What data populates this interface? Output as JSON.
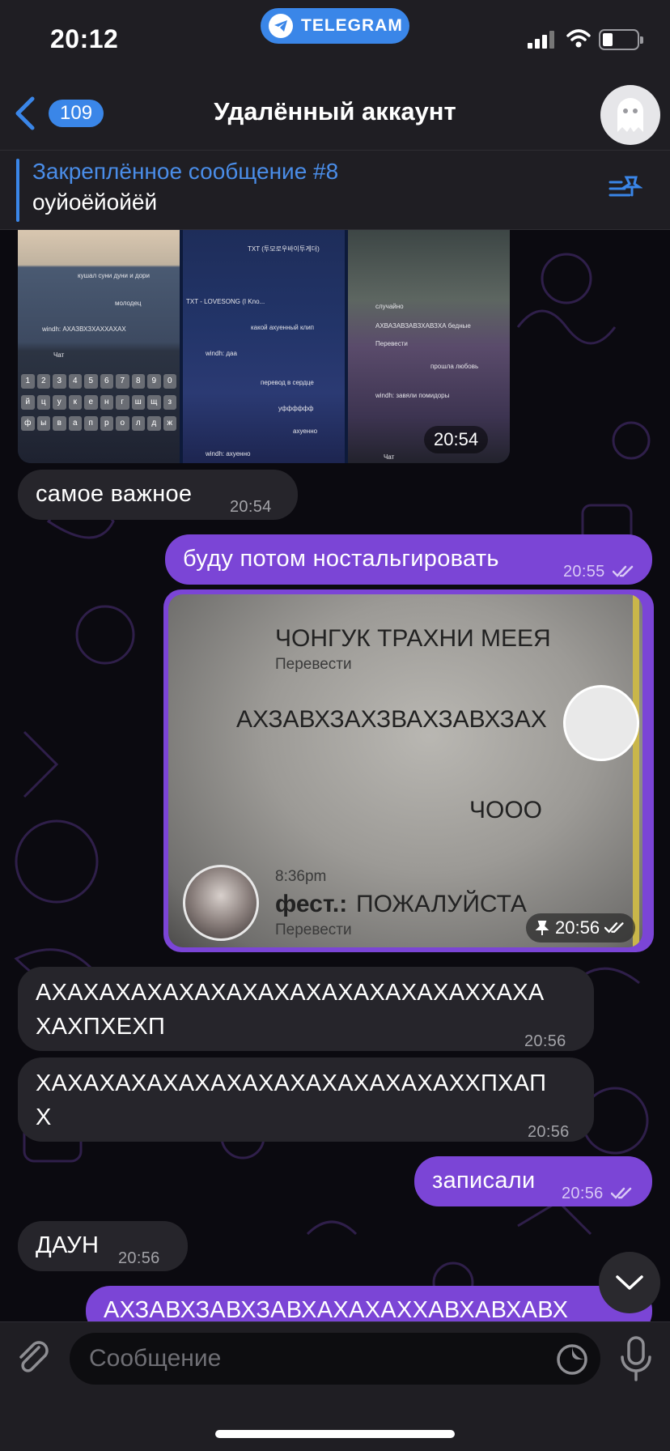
{
  "status_bar": {
    "time": "20:12",
    "app_pill": "TELEGRAM"
  },
  "header": {
    "back_count": "109",
    "title": "Удалённый аккаунт"
  },
  "pinned": {
    "title": "Закреплённое сообщение #8",
    "text": "оуйоёйойёй"
  },
  "media_group": {
    "time": "20:54",
    "screenshots": [
      {
        "lines": [
          "кушал суни дуни и дори",
          "молодец",
          "windh: АХАЗВХЗХАХХАХАХ",
          "Чат"
        ]
      },
      {
        "lines": [
          "TXT (투모로우바이투게더)",
          "TXT - LOVESONG (I Kno...",
          "какой ахуенный клип",
          "windh: даа",
          "перевод в сердце",
          "уфффффф",
          "ахуенно",
          "windh: ахуенно"
        ]
      },
      {
        "lines": [
          "случайно",
          "АХВАЗАВЗАВЗХАВЗХА бедные",
          "Перевести",
          "прошла любовь",
          "windh: завяли помидоры",
          "Чат"
        ]
      }
    ],
    "keyboard_rows": [
      [
        "1",
        "2",
        "3",
        "4",
        "5",
        "6",
        "7",
        "8",
        "9",
        "0"
      ],
      [
        "й",
        "ц",
        "у",
        "к",
        "е",
        "н",
        "г",
        "ш",
        "щ",
        "з"
      ],
      [
        "ф",
        "ы",
        "в",
        "а",
        "п",
        "р",
        "о",
        "л",
        "д",
        "ж"
      ]
    ]
  },
  "messages": [
    {
      "id": "m1",
      "dir": "in",
      "text": "самое важное",
      "time": "20:54"
    },
    {
      "id": "m2",
      "dir": "out",
      "text": "буду потом ностальгировать",
      "time": "20:55"
    },
    {
      "id": "m3",
      "dir": "out",
      "type": "photo",
      "time": "20:56",
      "photo": {
        "line1": "ЧОНГУК ТРАХНИ МЕЕЯ",
        "translate1": "Перевести",
        "line2": "АХЗАВХЗАХЗВАХЗАВХЗАХ",
        "line3": "ЧОOO",
        "stamp": "8:36pm",
        "sender": "фест.:",
        "line4": "ПОЖАЛУЙСТА",
        "translate2": "Перевести"
      }
    },
    {
      "id": "m4",
      "dir": "in",
      "line1": "АХАХАХАХАХАХАХАХАХАХАХАХАХАХХАХА",
      "line2": "ХАХПХЕХП",
      "time": "20:56"
    },
    {
      "id": "m5",
      "dir": "in",
      "line1": "ХАХАХАХАХАХАХАХАХАХАХАХАХАХХПХАП",
      "line2": "Х",
      "time": "20:56"
    },
    {
      "id": "m6",
      "dir": "out",
      "text": "записали",
      "time": "20:56"
    },
    {
      "id": "m7",
      "dir": "in",
      "text": "ДАУН",
      "time": "20:56"
    },
    {
      "id": "m8",
      "dir": "out",
      "text": "АХЗАВХЗАВХЗАВХАХАХАХХАВХАВХАВХ"
    }
  ],
  "composer": {
    "placeholder": "Сообщение"
  },
  "colors": {
    "accent": "#3a86e8",
    "outgoing_bubble": "#7b45d6",
    "incoming_bubble": "#26252b"
  }
}
